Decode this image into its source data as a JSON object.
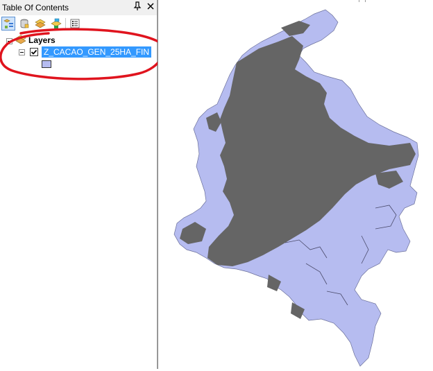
{
  "toc": {
    "title": "Table Of Contents",
    "pin_icon": "pushpin-icon",
    "close_icon": "close-icon",
    "toolbar": {
      "buttons": [
        {
          "name": "list-by-drawing-order",
          "icon": "list-by-drawing-order-icon",
          "active": true
        },
        {
          "name": "list-by-source",
          "icon": "list-by-source-icon",
          "active": false
        },
        {
          "name": "list-by-visibility",
          "icon": "list-by-visibility-icon",
          "active": false
        },
        {
          "name": "list-by-selection",
          "icon": "list-by-selection-icon",
          "active": false
        },
        {
          "name": "options",
          "icon": "options-icon",
          "active": false
        }
      ]
    },
    "tree": {
      "root_label": "Layers",
      "layer": {
        "name": "Z_CACAO_GEN_25HA_FIN",
        "checked": true,
        "symbol_color": "#b6bcf0"
      }
    }
  },
  "annotation": {
    "color": "#e0141e"
  },
  "map": {
    "fill_color": "#b6bcf0",
    "overlay_color": "#656565"
  }
}
